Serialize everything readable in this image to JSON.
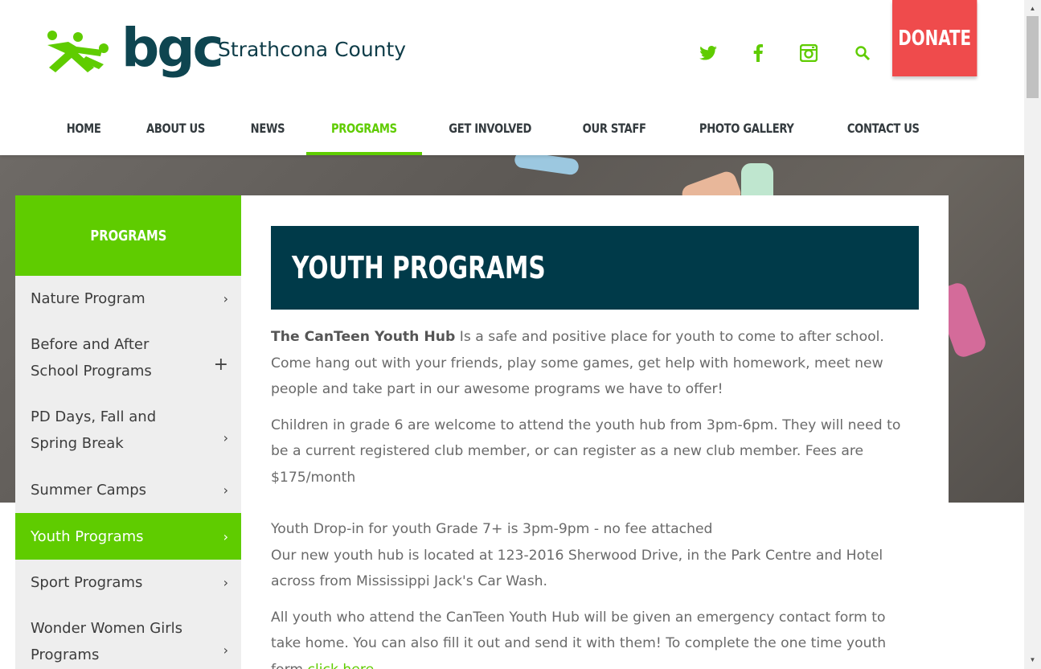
{
  "brand": {
    "logo_text": "bgc",
    "county": "Strathcona County",
    "accent": "#5fcc00",
    "dark": "#003a49",
    "donate_color": "#ef4b4c"
  },
  "header": {
    "social": [
      {
        "name": "twitter-icon"
      },
      {
        "name": "facebook-icon"
      },
      {
        "name": "instagram-icon"
      },
      {
        "name": "search-icon"
      }
    ],
    "donate_label": "DONATE"
  },
  "nav": {
    "items": [
      {
        "label": "HOME"
      },
      {
        "label": "ABOUT US"
      },
      {
        "label": "NEWS"
      },
      {
        "label": "PROGRAMS",
        "active": true
      },
      {
        "label": "GET INVOLVED"
      },
      {
        "label": "OUR STAFF"
      },
      {
        "label": "PHOTO GALLERY"
      },
      {
        "label": "CONTACT US"
      }
    ]
  },
  "sidebar": {
    "heading": "PROGRAMS",
    "items": [
      {
        "label": "Nature Program",
        "icon": "chevron-right-icon",
        "glyph": "›"
      },
      {
        "label": "Before and After School Programs",
        "icon": "plus-icon",
        "glyph": "+"
      },
      {
        "label": "PD Days, Fall and Spring Break",
        "icon": "chevron-right-icon",
        "glyph": "›"
      },
      {
        "label": "Summer Camps",
        "icon": "chevron-right-icon",
        "glyph": "›"
      },
      {
        "label": "Youth Programs",
        "icon": "chevron-right-icon",
        "glyph": "›",
        "active": true
      },
      {
        "label": "Sport Programs",
        "icon": "chevron-right-icon",
        "glyph": "›"
      },
      {
        "label": "Wonder Women Girls Programs",
        "icon": "chevron-right-icon",
        "glyph": "›"
      }
    ]
  },
  "main": {
    "title": "YOUTH PROGRAMS",
    "p1_bold": "The CanTeen Youth Hub",
    "p1_text": "  Is a safe and positive place for youth to come to after school. Come hang out with your friends, play some games, get help with homework, meet new people and take part in our awesome programs we have to offer!",
    "p2": "Children in grade 6 are welcome to attend the youth hub from 3pm-6pm. They will need to be a current registered club member, or can register as a new club member. Fees are $175/month",
    "p3_line1": "Youth Drop-in for youth Grade 7+ is 3pm-9pm - no fee attached",
    "p3_line2": "Our new youth hub is located at 123-2016 Sherwood Drive, in the Park Centre and Hotel across from Mississippi Jack's Car Wash.",
    "p4": "All youth who attend the CanTeen Youth Hub will be given an emergency contact form to take home. You can also fill it out and send it with them! To complete the one time youth form ",
    "p4_link": "click here"
  }
}
